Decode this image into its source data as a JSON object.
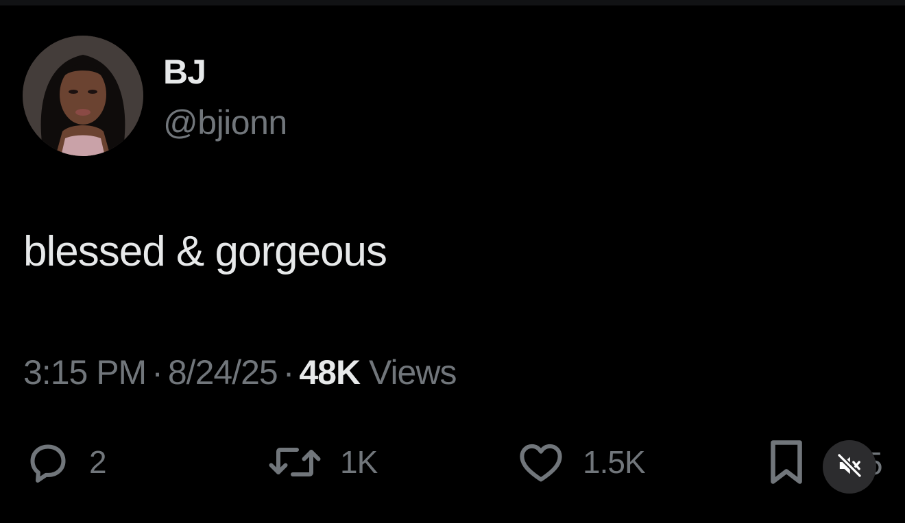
{
  "user": {
    "display_name": "BJ",
    "handle": "@bjionn"
  },
  "tweet": {
    "text": "blessed & gorgeous",
    "time": "3:15 PM",
    "separator": "·",
    "date": "8/24/25",
    "views_count": "48K",
    "views_label": "Views"
  },
  "actions": {
    "reply_count": "2",
    "retweet_count": "1K",
    "like_count": "1.5K",
    "share_count_partial": "5"
  },
  "icons": {
    "reply": "reply-icon",
    "retweet": "retweet-icon",
    "like": "heart-icon",
    "bookmark": "bookmark-icon",
    "mute": "speaker-muted-icon"
  },
  "colors": {
    "background": "#000000",
    "primary_text": "#e7e9ea",
    "secondary_text": "#71767b",
    "mute_button_bg": "#2c2c2e"
  }
}
